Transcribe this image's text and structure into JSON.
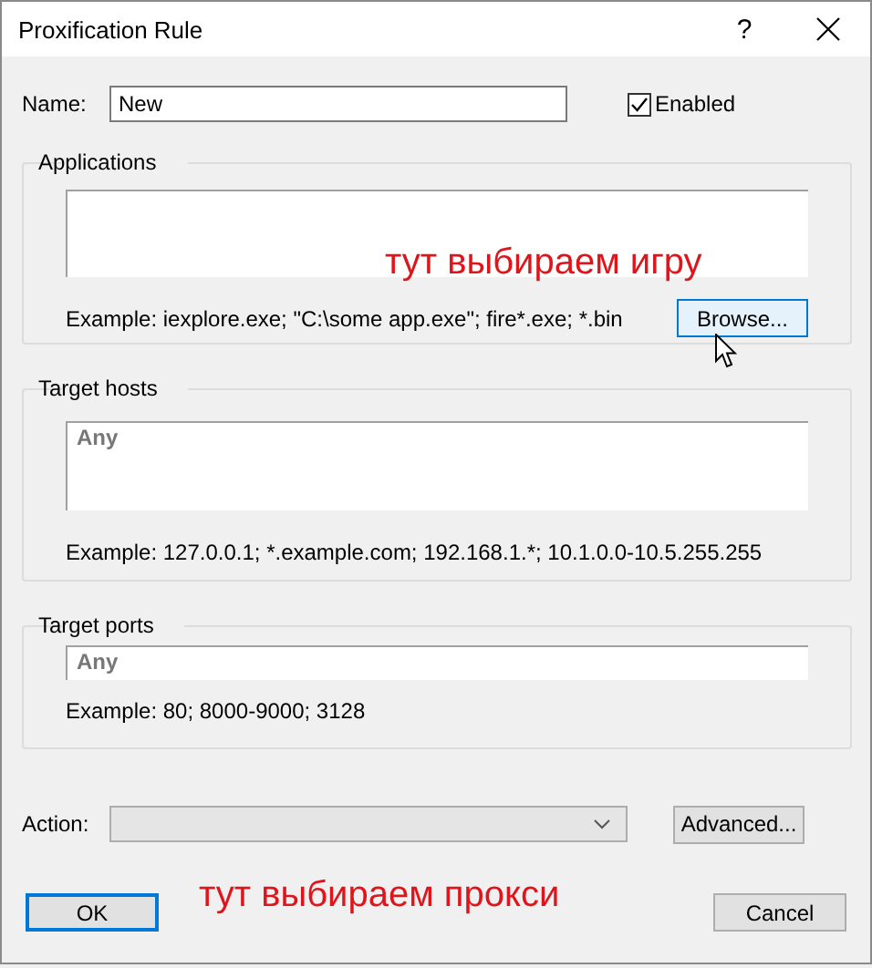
{
  "window": {
    "title": "Proxification Rule",
    "help": "?"
  },
  "name": {
    "label": "Name:",
    "value": "New"
  },
  "enabled": {
    "label": "Enabled",
    "checked": true
  },
  "groups": [
    {
      "kind": "list",
      "title": "Applications",
      "example": "Example: iexplore.exe; \"C:\\some app.exe\"; fire*.exe; *.bin",
      "button": "Browse...",
      "annotation": "тут выбираем игру"
    },
    {
      "kind": "multiline",
      "title": "Target hosts",
      "placeholder": "Any",
      "example": "Example: 127.0.0.1; *.example.com; 192.168.1.*; 10.1.0.0-10.5.255.255"
    },
    {
      "kind": "single",
      "title": "Target ports",
      "placeholder": "Any",
      "example": "Example: 80; 8000-9000; 3128"
    }
  ],
  "action": {
    "label": "Action:",
    "button": "Advanced..."
  },
  "annotation": "тут выбираем прокси",
  "buttons": [
    {
      "label": "OK",
      "default": true
    },
    {
      "label": "Cancel",
      "default": false
    }
  ]
}
